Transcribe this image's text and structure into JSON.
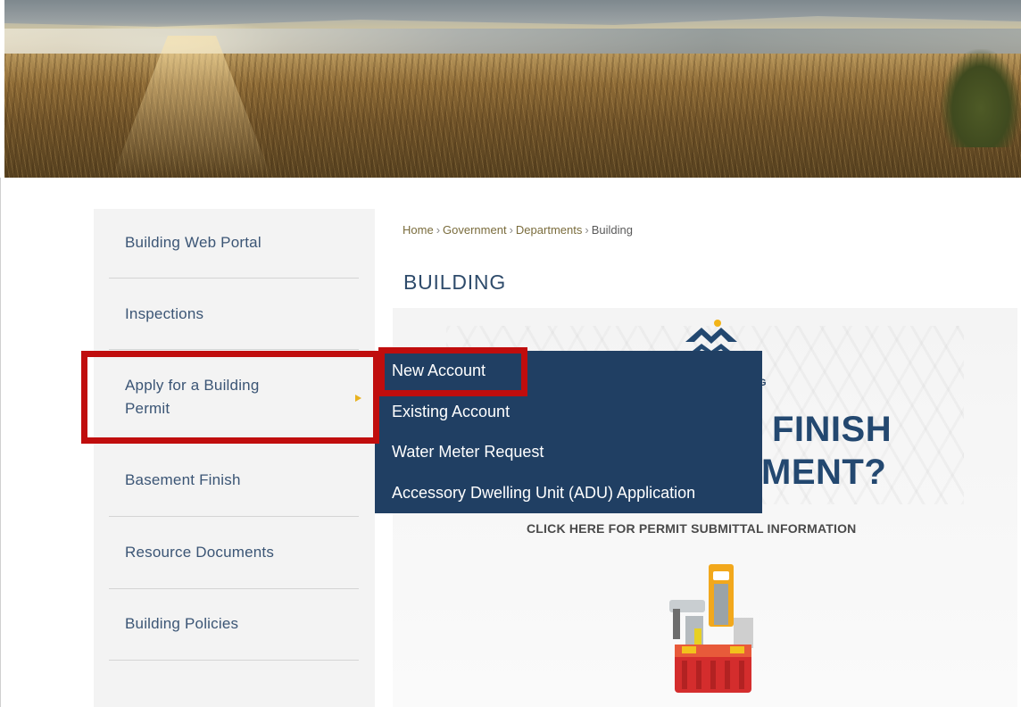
{
  "sidebar": {
    "items": [
      {
        "label": "Building Web Portal"
      },
      {
        "label": "Inspections"
      },
      {
        "label": "Apply for a Building Permit"
      },
      {
        "label": "Basement Finish"
      },
      {
        "label": "Resource Documents"
      },
      {
        "label": "Building Policies"
      }
    ]
  },
  "breadcrumb": {
    "items": [
      "Home",
      "Government",
      "Departments",
      "Building"
    ],
    "separator": "›"
  },
  "page": {
    "title": "BUILDING"
  },
  "flyout": {
    "items": [
      {
        "label": "New Account"
      },
      {
        "label": "Existing Account"
      },
      {
        "label": "Water Meter Request"
      },
      {
        "label": "Accessory Dwelling Unit (ADU) Application"
      }
    ]
  },
  "promo": {
    "small_text": "G",
    "headline_line1": "FINISH",
    "headline_line2": "MENT?",
    "cta": "CLICK HERE FOR PERMIT SUBMITTAL INFORMATION"
  },
  "colors": {
    "nav_text": "#3b5575",
    "flyout_bg": "#203f63",
    "highlight": "#c00d0d",
    "accent_arrow": "#e8b220",
    "headline": "#234870"
  },
  "icons": {
    "logo": "mountain-logo-icon",
    "submenu_arrow": "triangle-right-icon",
    "promo_art": "toolbox-icon"
  }
}
